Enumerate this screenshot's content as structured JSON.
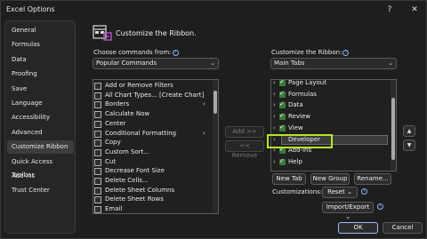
{
  "window": {
    "title": "Excel Options",
    "help": "?",
    "close": "✕"
  },
  "sidebar": {
    "items": [
      {
        "label": "General"
      },
      {
        "label": "Formulas"
      },
      {
        "label": "Data"
      },
      {
        "label": "Proofing"
      },
      {
        "label": "Save"
      },
      {
        "label": "Language"
      },
      {
        "label": "Accessibility"
      },
      {
        "label": "Advanced"
      },
      {
        "label": "Customize Ribbon",
        "selected": true
      },
      {
        "label": "Quick Access Toolbar"
      },
      {
        "label": "Add-ins"
      },
      {
        "label": "Trust Center"
      }
    ]
  },
  "main": {
    "heading": "Customize the Ribbon.",
    "choose_label": "Choose commands from:",
    "choose_value": "Popular Commands",
    "customize_label": "Customize the Ribbon:",
    "customize_value": "Main Tabs",
    "info_glyph": "i",
    "chevron": "⌄"
  },
  "commands": [
    {
      "label": "Add or Remove Filters"
    },
    {
      "label": "All Chart Types... [Create Chart]"
    },
    {
      "label": "Borders",
      "submenu": true
    },
    {
      "label": "Calculate Now"
    },
    {
      "label": "Center"
    },
    {
      "label": "Conditional Formatting",
      "submenu": true
    },
    {
      "label": "Copy"
    },
    {
      "label": "Custom Sort..."
    },
    {
      "label": "Cut"
    },
    {
      "label": "Decrease Font Size"
    },
    {
      "label": "Delete Cells..."
    },
    {
      "label": "Delete Sheet Columns"
    },
    {
      "label": "Delete Sheet Rows"
    },
    {
      "label": "Email"
    }
  ],
  "submenu_glyph": "›",
  "middle_buttons": {
    "add": "Add >>",
    "remove": "<< Remove"
  },
  "tabs": [
    {
      "label": "Page Layout",
      "checked": true
    },
    {
      "label": "Formulas",
      "checked": true
    },
    {
      "label": "Data",
      "checked": true
    },
    {
      "label": "Review",
      "checked": true
    },
    {
      "label": "View",
      "checked": true
    },
    {
      "label": "Developer",
      "checked": true,
      "selected": true
    },
    {
      "label": "Add-ins",
      "checked": true
    },
    {
      "label": "Help",
      "checked": true
    }
  ],
  "expand_glyph": "›",
  "updown": {
    "up": "▲",
    "down": "▼"
  },
  "bottom_buttons": {
    "new_tab": "New Tab",
    "new_group": "New Group",
    "rename": "Rename..."
  },
  "customizations": {
    "label": "Customizations:",
    "reset": "Reset",
    "import_export": "Import/Export"
  },
  "footer": {
    "ok": "OK",
    "cancel": "Cancel"
  }
}
